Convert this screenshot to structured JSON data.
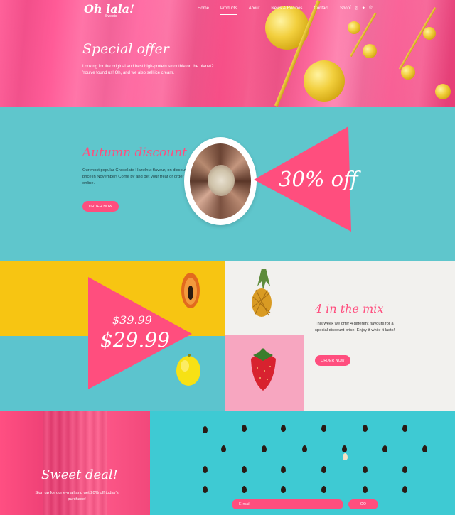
{
  "brand": {
    "logo": "Oh lala!",
    "tagline": "Sweets"
  },
  "nav": {
    "items": [
      {
        "label": "Home"
      },
      {
        "label": "Products",
        "active": true
      },
      {
        "label": "About"
      },
      {
        "label": "News & Recipes"
      },
      {
        "label": "Contact"
      },
      {
        "label": "Shop"
      }
    ],
    "social_icons": [
      "facebook-icon",
      "instagram-icon",
      "twitter-icon",
      "pinterest-icon"
    ]
  },
  "hero": {
    "title": "Special offer",
    "text": "Looking for the original and best high-protein smoothie on the planet? You've found us! Oh, and we also sell ice cream."
  },
  "autumn": {
    "title": "Autumn discount",
    "text": "Our most popular Chocolate-Hazelnut flavour, on discount price in November! Come by and get your treat or order online.",
    "button": "ORDER NOW",
    "badge": "30% off"
  },
  "mix": {
    "old_price": "$39.99",
    "new_price": "$29.99",
    "title": "4 in the mix",
    "text": "This week we offer 4 different flavours for a special discount price. Enjoy it while it lasts!",
    "button": "ORDER NOW"
  },
  "sweet": {
    "title": "Sweet deal!",
    "text": "Sign up for our e-mail and get 20% off today's purchase!",
    "email_placeholder": "E-mail",
    "go_button": "GO"
  },
  "colors": {
    "accent_pink": "#ff4e7e",
    "teal": "#5fc6cc",
    "yellow": "#f7c512",
    "gold": "#e2b92a"
  }
}
